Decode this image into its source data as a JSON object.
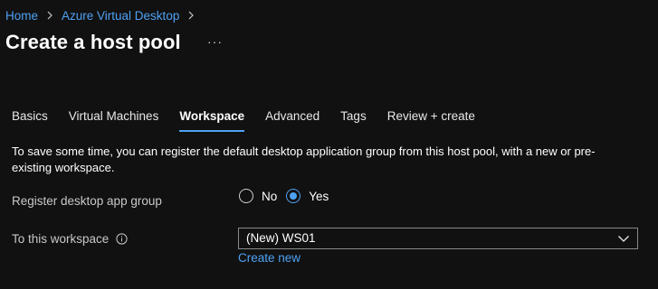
{
  "breadcrumb": {
    "items": [
      "Home",
      "Azure Virtual Desktop"
    ]
  },
  "page": {
    "title": "Create a host pool",
    "more_label": "···"
  },
  "tabs": [
    {
      "label": "Basics"
    },
    {
      "label": "Virtual Machines"
    },
    {
      "label": "Workspace",
      "active": true
    },
    {
      "label": "Advanced"
    },
    {
      "label": "Tags"
    },
    {
      "label": "Review + create"
    }
  ],
  "workspace": {
    "description": "To save some time, you can register the default desktop application group from this host pool, with a new or pre-existing workspace.",
    "register": {
      "label": "Register desktop app group",
      "options": [
        "No",
        "Yes"
      ],
      "selected": "Yes"
    },
    "workspace_field": {
      "label": "To this workspace",
      "value": "(New) WS01",
      "create_new": "Create new"
    }
  },
  "colors": {
    "background": "#111111",
    "accent": "#4ea1f3",
    "text": "#ffffff",
    "muted_text": "#c8c8c8"
  },
  "icons": [
    "chevron-right-icon",
    "more-icon",
    "info-icon",
    "chevron-down-icon"
  ]
}
